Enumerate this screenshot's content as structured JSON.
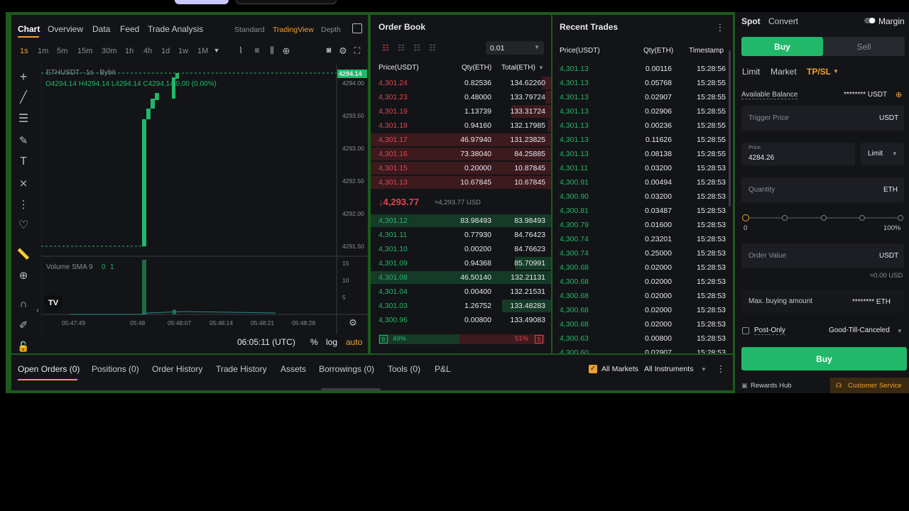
{
  "chart": {
    "tabs": [
      "Chart",
      "Overview",
      "Data",
      "Feed",
      "Trade Analysis"
    ],
    "views": [
      "Standard",
      "TradingView",
      "Depth"
    ],
    "intervals": [
      "1s",
      "1m",
      "5m",
      "15m",
      "30m",
      "1h",
      "4h",
      "1d",
      "1w",
      "1M"
    ],
    "symbol": "ETHUSDT · 1s · Bybit",
    "ohlc": {
      "o": "O4294.14",
      "h": "H4294.14",
      "l": "L4294.14",
      "c": "C4294.14",
      "chg": "0.00 (0.00%)"
    },
    "price_tag": "4294.14",
    "price_axis": [
      "4294.00",
      "4293.50",
      "4293.00",
      "4292.50",
      "4292.00",
      "4291.50"
    ],
    "volume_label": "Volume SMA 9",
    "volume_values": [
      "0",
      "1"
    ],
    "volume_axis": [
      "15",
      "10",
      "5"
    ],
    "time_axis": [
      "05:47:49",
      "05:48",
      "05:48:07",
      "05:48:14",
      "05:48:21",
      "05:48:28"
    ],
    "clock": "06:05:11 (UTC)",
    "scale_opts": [
      "%",
      "log",
      "auto"
    ],
    "logo": "TV"
  },
  "order_book": {
    "title": "Order Book",
    "precision": "0.01",
    "headers": [
      "Price(USDT)",
      "Qty(ETH)",
      "Total(ETH)"
    ],
    "asks": [
      {
        "price": "4,301.24",
        "qty": "0.82536",
        "total": "134.62260",
        "depth": 0.05
      },
      {
        "price": "4,301.23",
        "qty": "0.48000",
        "total": "133.79724",
        "depth": 0.03
      },
      {
        "price": "4,301.19",
        "qty": "1.13739",
        "total": "133.31724",
        "depth": 0.22
      },
      {
        "price": "4,301.18",
        "qty": "0.94160",
        "total": "132.17985",
        "depth": 0.02
      },
      {
        "price": "4,301.17",
        "qty": "46.97940",
        "total": "131.23825",
        "depth": 1.0
      },
      {
        "price": "4,301.16",
        "qty": "73.38040",
        "total": "84.25885",
        "depth": 1.0
      },
      {
        "price": "4,301.15",
        "qty": "0.20000",
        "total": "10.87845",
        "depth": 1.0
      },
      {
        "price": "4,301.13",
        "qty": "10.67845",
        "total": "10.67845",
        "depth": 1.0
      }
    ],
    "last_price": "↓4,293.77",
    "last_usd": "≈4,293.77 USD",
    "bids": [
      {
        "price": "4,301.12",
        "qty": "83.98493",
        "total": "83.98493",
        "depth": 1.0
      },
      {
        "price": "4,301.11",
        "qty": "0.77930",
        "total": "84.76423",
        "depth": 0.0
      },
      {
        "price": "4,301.10",
        "qty": "0.00200",
        "total": "84.76623",
        "depth": 0.0
      },
      {
        "price": "4,301.09",
        "qty": "0.94368",
        "total": "85.70991",
        "depth": 0.2
      },
      {
        "price": "4,301.08",
        "qty": "46.50140",
        "total": "132.21131",
        "depth": 1.0
      },
      {
        "price": "4,301.04",
        "qty": "0.00400",
        "total": "132.21531",
        "depth": 0.0
      },
      {
        "price": "4,301.03",
        "qty": "1.26752",
        "total": "133.48283",
        "depth": 0.27
      },
      {
        "price": "4,300.96",
        "qty": "0.00800",
        "total": "133.49083",
        "depth": 0.0
      }
    ],
    "buy_label": "B",
    "buy_pct": "49%",
    "sell_pct": "51%",
    "sell_label": "S"
  },
  "recent_trades": {
    "title": "Recent Trades",
    "headers": [
      "Price(USDT)",
      "Qty(ETH)",
      "Timestamp"
    ],
    "rows": [
      {
        "price": "4,301.13",
        "qty": "0.00116",
        "time": "15:28:56"
      },
      {
        "price": "4,301.13",
        "qty": "0.05768",
        "time": "15:28:55"
      },
      {
        "price": "4,301.13",
        "qty": "0.02907",
        "time": "15:28:55"
      },
      {
        "price": "4,301.13",
        "qty": "0.02906",
        "time": "15:28:55"
      },
      {
        "price": "4,301.13",
        "qty": "0.00236",
        "time": "15:28:55"
      },
      {
        "price": "4,301.13",
        "qty": "0.11626",
        "time": "15:28:55"
      },
      {
        "price": "4,301.13",
        "qty": "0.08138",
        "time": "15:28:55"
      },
      {
        "price": "4,301.11",
        "qty": "0.03200",
        "time": "15:28:53"
      },
      {
        "price": "4,300.91",
        "qty": "0.00494",
        "time": "15:28:53"
      },
      {
        "price": "4,300.90",
        "qty": "0.03200",
        "time": "15:28:53"
      },
      {
        "price": "4,300.81",
        "qty": "0.03487",
        "time": "15:28:53"
      },
      {
        "price": "4,300.79",
        "qty": "0.01600",
        "time": "15:28:53"
      },
      {
        "price": "4,300.74",
        "qty": "0.23201",
        "time": "15:28:53"
      },
      {
        "price": "4,300.74",
        "qty": "0.25000",
        "time": "15:28:53"
      },
      {
        "price": "4,300.68",
        "qty": "0.02000",
        "time": "15:28:53"
      },
      {
        "price": "4,300.68",
        "qty": "0.02000",
        "time": "15:28:53"
      },
      {
        "price": "4,300.68",
        "qty": "0.02000",
        "time": "15:28:53"
      },
      {
        "price": "4,300.68",
        "qty": "0.02000",
        "time": "15:28:53"
      },
      {
        "price": "4,300.68",
        "qty": "0.02000",
        "time": "15:28:53"
      },
      {
        "price": "4,300.63",
        "qty": "0.00800",
        "time": "15:28:53"
      },
      {
        "price": "4,300.60",
        "qty": "0.02907",
        "time": "15:28:53"
      }
    ]
  },
  "trade": {
    "top_tabs": [
      "Spot",
      "Convert"
    ],
    "margin_label": "Margin",
    "buy": "Buy",
    "sell": "Sell",
    "order_types": [
      "Limit",
      "Market",
      "TP/SL"
    ],
    "balance_label": "Available Balance",
    "balance_value": "******** USDT",
    "trigger_placeholder": "Trigger Price",
    "trigger_unit": "USDT",
    "price_label": "Price",
    "price_value": "4284.26",
    "price_mode": "Limit",
    "qty_placeholder": "Quantity",
    "qty_unit": "ETH",
    "slider_min": "0",
    "slider_max": "100%",
    "order_value_placeholder": "Order Value",
    "order_value_unit": "USDT",
    "order_value_approx": "≈0.00 USD",
    "max_buy_label": "Max. buying amount",
    "max_buy_value": "******** ETH",
    "post_only": "Post-Only",
    "tif": "Good-Till-Canceled",
    "buy_button": "Buy",
    "rewards": "Rewards Hub",
    "customer_service": "Customer Service"
  },
  "bottom": {
    "tabs": [
      "Open Orders (0)",
      "Positions (0)",
      "Order History",
      "Trade History",
      "Assets",
      "Borrowings (0)",
      "Tools (0)",
      "P&L"
    ],
    "all_markets": "All Markets",
    "all_instruments": "All Instruments"
  },
  "colors": {
    "green": "#21b86a",
    "red": "#e0454f",
    "accent": "#f0a030",
    "buy": "#21b86a"
  }
}
